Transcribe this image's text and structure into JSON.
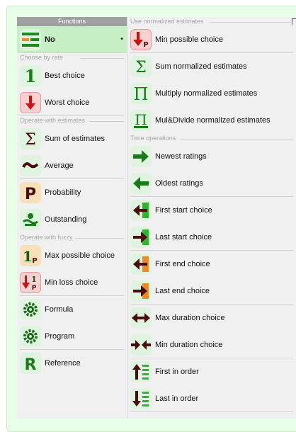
{
  "left": {
    "header": "Functions",
    "no_item": "No",
    "groups": {
      "rate": "Choose by rate",
      "estimates": "Operate with estimates",
      "fuzzy": "Operate with fuzzy"
    },
    "items": {
      "best": "Best choice",
      "worst": "Worst choice",
      "sum": "Sum of estimates",
      "average": "Average",
      "probability": "Probability",
      "outstanding": "Outstanding",
      "max_possible": "Max possible choice",
      "min_loss": "Min loss choice",
      "formula": "Formula",
      "program": "Program",
      "reference": "Reference"
    }
  },
  "right": {
    "groups": {
      "normalized": "Use normalized estimates",
      "time": "Time operations"
    },
    "items": {
      "min_possible": "Min possible choice",
      "sum_norm": "Sum normalized estimates",
      "mul_norm": "Multiply normalized estimates",
      "muldiv_norm": "Mul&Divide normalized estimates",
      "newest": "Newest ratings",
      "oldest": "Oldest ratings",
      "first_start": "First start choice",
      "last_start": "Last start choice",
      "first_end": "First end choice",
      "last_end": "Last end choice",
      "max_duration": "Max duration choice",
      "min_duration": "Min duration choice",
      "first_order": "First in order",
      "last_order": "Last in order"
    }
  },
  "icon_glyphs": {
    "best": "1",
    "sum": "Σ",
    "multiply": "Π",
    "probability": "P",
    "reference": "R",
    "fuzzy_p": "P",
    "tilde": "~"
  },
  "colors": {
    "green": "#1a7a1a",
    "red": "#cc1111",
    "orange": "#f08a20",
    "dark_red": "#4a0b0b",
    "selected": "#c6efc6"
  }
}
